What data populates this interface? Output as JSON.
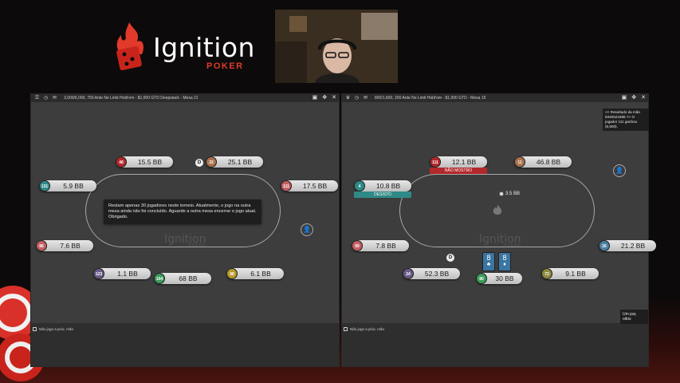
{
  "colors": {
    "brand_red": "#e23a2a",
    "seat_red": "#b3282b",
    "seat_orange": "#a9714d",
    "seat_teal": "#2f8a87",
    "seat_green": "#3c9b5c",
    "seat_pink": "#c45e63",
    "seat_purple": "#6a5b8a",
    "seat_gold": "#b79a2c",
    "seat_steel": "#4d7fa0",
    "seat_olive": "#8d8a3d",
    "card_blue": "#3a76a3"
  },
  "logo": {
    "word": "Ignition",
    "sub": "POKER"
  },
  "left_table": {
    "title": "3,000/6,000, 750 Ante No Limit Hold'em - $1,000 GTD Deepstack - Mesa 21",
    "notice": "Restam apenas 30 jogadores neste torneio. Atualmente, o jogo na outra mesa ainda não foi concluído. Aguarde a outra mesa encerrar o jogo atual. Obrigado.",
    "felt_logo": "Ignition",
    "felt_logo_sub": "POKER",
    "sit_out_label": "Não jogo a próx. mão",
    "dealer": "D",
    "seats": [
      {
        "id": "48",
        "stack": "15.5 BB",
        "color": "seat_red"
      },
      {
        "id": "22",
        "stack": "25.1 BB",
        "color": "seat_orange"
      },
      {
        "id": "131",
        "stack": "5.9 BB",
        "color": "seat_teal"
      },
      {
        "id": "111",
        "stack": "17.5 BB",
        "color": "seat_pink"
      },
      {
        "id": "86",
        "stack": "7.6 BB",
        "color": "seat_pink"
      },
      {
        "id": "123",
        "stack": "1.1 BB",
        "color": "seat_purple"
      },
      {
        "id": "104",
        "stack": "68 BB",
        "color": "seat_green"
      },
      {
        "id": "98",
        "stack": "6.1 BB",
        "color": "seat_gold"
      }
    ]
  },
  "right_table": {
    "title": "800/1,600, 200 Ante No Limit Hold'em - $1,000 GTD - Mesa 15",
    "hand_result": "<< Resultado da mão 5340524486 >> O jogador 111 ganhou (5,600).",
    "pot": "3.5 BB",
    "felt_logo": "Ignition",
    "felt_logo_sub": "POKER",
    "sit_out_label": "Não jogo a próx. mão",
    "toast": "Um par, oitos",
    "dealer": "D",
    "hero_cards": [
      "8",
      "8"
    ],
    "seats": [
      {
        "id": "111",
        "stack": "12.1 BB",
        "color": "seat_red",
        "tag": "NÃO MOSTRO"
      },
      {
        "id": "11",
        "stack": "46.8 BB",
        "color": "seat_orange"
      },
      {
        "id": "4",
        "stack": "10.8 BB",
        "color": "seat_teal",
        "tag": "DESISTO"
      },
      {
        "id": "99",
        "stack": "7.8 BB",
        "color": "seat_pink"
      },
      {
        "id": "26",
        "stack": "21.2 BB",
        "color": "seat_steel"
      },
      {
        "id": "24",
        "stack": "52.3 BB",
        "color": "seat_purple"
      },
      {
        "id": "80",
        "stack": "30 BB",
        "color": "seat_green"
      },
      {
        "id": "73",
        "stack": "9.1 BB",
        "color": "seat_olive"
      }
    ]
  }
}
